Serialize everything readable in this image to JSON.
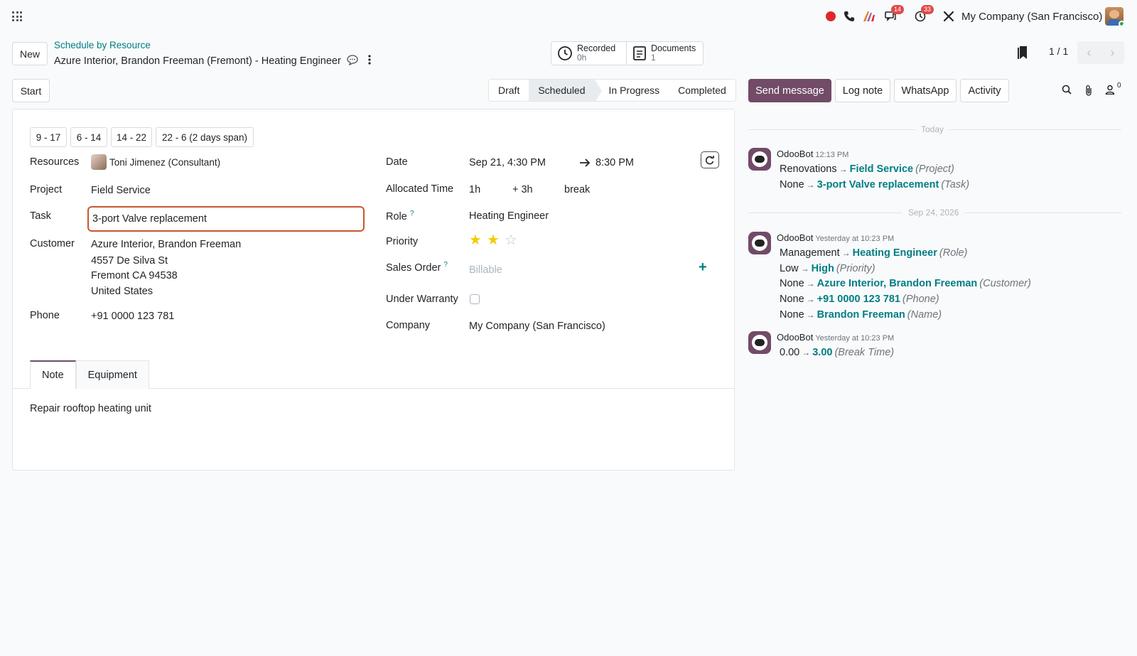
{
  "navbar": {
    "badge_messages": "14",
    "badge_activities": "33",
    "company": "My Company (San Francisco)"
  },
  "control": {
    "new_label": "New",
    "breadcrumb": "Schedule by Resource",
    "record_title": "Azure Interior, Brandon Freeman (Fremont) - Heating Engineer",
    "smart_buttons": [
      {
        "label": "Recorded",
        "value": "0h"
      },
      {
        "label": "Documents",
        "value": "1"
      }
    ],
    "pager": "1 / 1"
  },
  "statusbar": {
    "start_label": "Start",
    "stages": [
      "Draft",
      "Scheduled",
      "In Progress",
      "Completed"
    ],
    "active_stage": "Scheduled"
  },
  "form": {
    "shift_templates": [
      "9 - 17",
      "6 - 14",
      "14 - 22",
      "22 - 6 (2 days span)"
    ],
    "resources_label": "Resources",
    "resource_value": "Toni Jimenez (Consultant)",
    "project_label": "Project",
    "project_value": "Field Service",
    "task_label": "Task",
    "task_value": "3-port Valve replacement",
    "customer_label": "Customer",
    "customer_name": "Azure Interior, Brandon Freeman",
    "customer_street": "4557 De Silva St",
    "customer_city": "Fremont CA 94538",
    "customer_country": "United States",
    "phone_label": "Phone",
    "phone_value": "+91 0000 123 781",
    "date_label": "Date",
    "date_start": "Sep 21, 4:30 PM",
    "date_end": "8:30 PM",
    "allocated_label": "Allocated Time",
    "allocated_value": "1h",
    "allocated_extra": "+ 3h",
    "allocated_break": "break",
    "role_label": "Role",
    "role_help": "?",
    "role_value": "Heating Engineer",
    "priority_label": "Priority",
    "priority_stars": 2,
    "priority_max": 3,
    "sales_order_label": "Sales Order",
    "sales_order_help": "?",
    "sales_order_placeholder": "Billable",
    "warranty_label": "Under Warranty",
    "warranty_checked": false,
    "company_label": "Company",
    "company_value": "My Company (San Francisco)",
    "tabs": [
      "Note",
      "Equipment"
    ],
    "note_text": "Repair rooftop heating unit"
  },
  "chatter": {
    "send_message": "Send message",
    "log_note": "Log note",
    "whatsapp": "WhatsApp",
    "activity": "Activity",
    "followers_count": "0",
    "separator_today": "Today",
    "separator_date": "Sep 24, 2026",
    "messages": [
      {
        "author": "OdooBot",
        "time": "12:13 PM",
        "changes": [
          {
            "old": "Renovations",
            "new": "Field Service",
            "field": "(Project)"
          },
          {
            "old": "None",
            "new": "3-port Valve replacement",
            "field": "(Task)"
          }
        ]
      },
      {
        "author": "OdooBot",
        "time": "Yesterday at 10:23 PM",
        "changes": [
          {
            "old": "Management",
            "new": "Heating Engineer",
            "field": "(Role)"
          },
          {
            "old": "Low",
            "new": "High",
            "field": "(Priority)"
          },
          {
            "old": "None",
            "new": "Azure Interior, Brandon Freeman",
            "field": "(Customer)"
          },
          {
            "old": "None",
            "new": "+91 0000 123 781",
            "field": "(Phone)"
          },
          {
            "old": "None",
            "new": "Brandon Freeman",
            "field": "(Name)"
          }
        ]
      },
      {
        "author": "OdooBot",
        "time": "Yesterday at 10:23 PM",
        "changes": [
          {
            "old": "0.00",
            "new": "3.00",
            "field": "(Break Time)"
          }
        ]
      }
    ]
  },
  "colors": {
    "brand": "#714b67",
    "link": "#017e84",
    "star": "#f3cc00",
    "focus_border": "#c9572e"
  }
}
